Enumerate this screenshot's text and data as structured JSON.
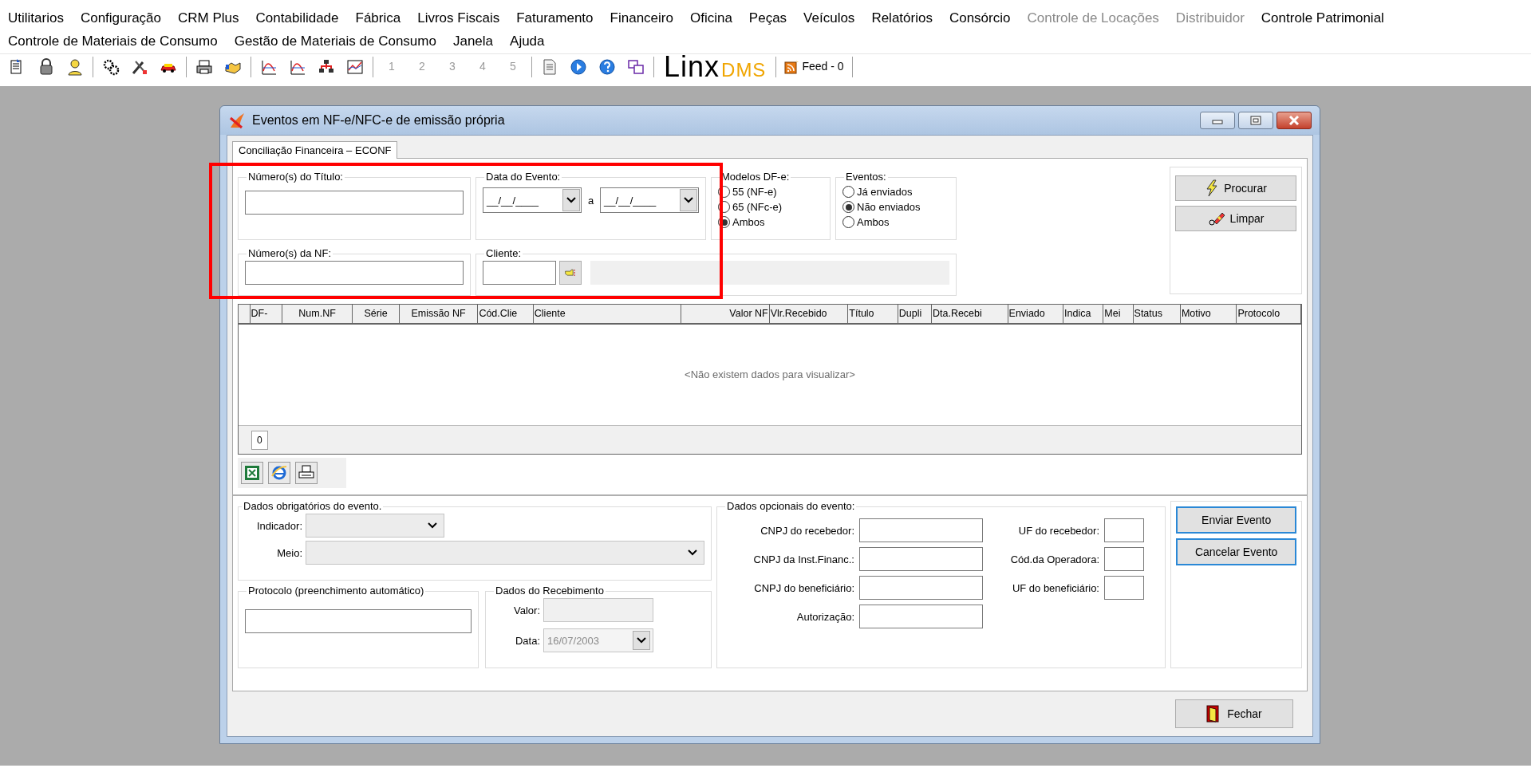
{
  "menu": {
    "items": [
      {
        "label": "Utilitarios",
        "disabled": false
      },
      {
        "label": "Configuração",
        "disabled": false
      },
      {
        "label": "CRM Plus",
        "disabled": false
      },
      {
        "label": "Contabilidade",
        "disabled": false
      },
      {
        "label": "Fábrica",
        "disabled": false
      },
      {
        "label": "Livros Fiscais",
        "disabled": false
      },
      {
        "label": "Faturamento",
        "disabled": false
      },
      {
        "label": "Financeiro",
        "disabled": false
      },
      {
        "label": "Oficina",
        "disabled": false
      },
      {
        "label": "Peças",
        "disabled": false
      },
      {
        "label": "Veículos",
        "disabled": false
      },
      {
        "label": "Relatórios",
        "disabled": false
      },
      {
        "label": "Consórcio",
        "disabled": false
      },
      {
        "label": "Controle de Locações",
        "disabled": true
      },
      {
        "label": "Distribuidor",
        "disabled": true
      },
      {
        "label": "Controle Patrimonial",
        "disabled": false
      },
      {
        "label": "Controle de Materiais de Consumo",
        "disabled": false
      },
      {
        "label": "Gestão de Materiais de Consumo",
        "disabled": false
      },
      {
        "label": "Janela",
        "disabled": false
      },
      {
        "label": "Ajuda",
        "disabled": false
      }
    ]
  },
  "toolbar": {
    "numbers": [
      {
        "label": "1",
        "disabled": true
      },
      {
        "label": "2",
        "disabled": true
      },
      {
        "label": "3",
        "disabled": true
      },
      {
        "label": "4",
        "disabled": true
      },
      {
        "label": "5",
        "disabled": true
      }
    ],
    "logo": {
      "text": "Linx",
      "accent": "DMS"
    },
    "feed": {
      "label": "Feed - 0"
    }
  },
  "window": {
    "title": "Eventos em NF-e/NFC-e de emissão própria"
  },
  "tabs": [
    {
      "label": "Conciliação Financeira – ECONF",
      "selected": true
    }
  ],
  "filters": {
    "titulo": {
      "legend": "Número(s) do Título:"
    },
    "data": {
      "legend": "Data do Evento:",
      "from": "__/__/____",
      "separator": "a",
      "to": "__/__/____"
    },
    "modelos": {
      "legend": "Modelos DF-e:",
      "options": [
        {
          "label": "55 (NF-e)",
          "selected": false
        },
        {
          "label": "65 (NFc-e)",
          "selected": false
        },
        {
          "label": "Ambos",
          "selected": true
        }
      ]
    },
    "eventos": {
      "legend": "Eventos:",
      "options": [
        {
          "label": "Já enviados",
          "selected": false
        },
        {
          "label": "Não enviados",
          "selected": true
        },
        {
          "label": "Ambos",
          "selected": false
        }
      ]
    },
    "nf": {
      "legend": "Número(s) da NF:"
    },
    "cliente": {
      "legend": "Cliente:"
    }
  },
  "actions": [
    {
      "label": "Procurar",
      "kind": "search"
    },
    {
      "label": "Limpar",
      "kind": "clear"
    }
  ],
  "table": {
    "columns": [
      {
        "label": "DF-"
      },
      {
        "label": "Num.NF"
      },
      {
        "label": "Série"
      },
      {
        "label": "Emissão NF"
      },
      {
        "label": "Cód.Clie"
      },
      {
        "label": "Cliente"
      },
      {
        "label": "Valor NF"
      },
      {
        "label": "Vlr.Recebido"
      },
      {
        "label": "Título"
      },
      {
        "label": "Dupli"
      },
      {
        "label": "Dta.Recebi"
      },
      {
        "label": "Enviado"
      },
      {
        "label": "Indica"
      },
      {
        "label": "Mei"
      },
      {
        "label": "Status"
      },
      {
        "label": "Motivo"
      },
      {
        "label": "Protocolo"
      }
    ],
    "empty_message": "<Não existem dados para visualizar>",
    "row_count": "0"
  },
  "mandatory": {
    "legend": "Dados obrigatórios do evento.",
    "fields": [
      {
        "label": "Indicador:",
        "kind": "short",
        "disabled": true
      },
      {
        "label": "Meio:",
        "kind": "long",
        "disabled": true
      }
    ]
  },
  "protocolo": {
    "legend": "Protocolo (preenchimento automático)"
  },
  "recebimento": {
    "legend": "Dados do Recebimento",
    "valor": {
      "label": "Valor:",
      "disabled": true
    },
    "data": {
      "label": "Data:",
      "value": "16/07/2003",
      "disabled": true
    }
  },
  "opcionais": {
    "legend": "Dados opcionais do evento:",
    "fields": [
      {
        "label": "CNPJ do recebedor:",
        "kind": "wide"
      },
      {
        "label": "UF do recebedor:",
        "kind": "narrow"
      },
      {
        "label": "CNPJ da Inst.Financ.:",
        "kind": "wide"
      },
      {
        "label": "Cód.da Operadora:",
        "kind": "narrow"
      },
      {
        "label": "CNPJ do beneficiário:",
        "kind": "wide"
      },
      {
        "label": "UF do beneficiário:",
        "kind": "narrow"
      },
      {
        "label": "Autorização:",
        "kind": "wide"
      }
    ]
  },
  "event_buttons": [
    {
      "label": "Enviar Evento"
    },
    {
      "label": "Cancelar Evento"
    }
  ],
  "close_button": {
    "label": "Fechar"
  }
}
